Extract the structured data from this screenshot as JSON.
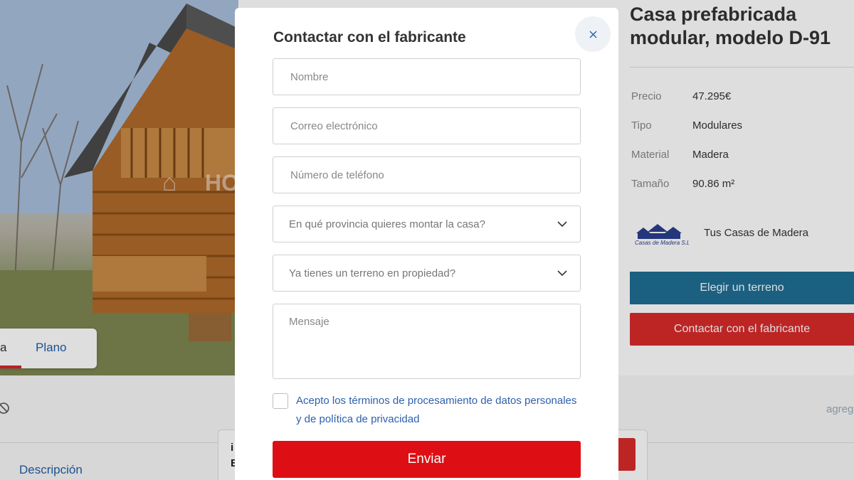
{
  "background": {
    "photo_tabs": {
      "tab_active_partial": "a",
      "tab_plan": "Plano"
    },
    "product": {
      "title": "Casa prefabricada modular, modelo D-91",
      "specs": [
        {
          "label": "Precio",
          "value": "47.295€"
        },
        {
          "label": "Tipo",
          "value": "Modulares"
        },
        {
          "label": "Material",
          "value": "Madera"
        },
        {
          "label": "Tamaño",
          "value": "90.86 m²"
        }
      ],
      "manufacturer": "Tus Casas de Madera",
      "manufacturer_logo_text": "Casas de Madera S.L",
      "choose_land_button": "Elegir un terreno",
      "contact_button": "Contactar con el fabricante"
    },
    "lower": {
      "partial_text_right": "agreg",
      "description_tab": "Descripción",
      "card_letters": [
        "i",
        "E"
      ]
    },
    "photo_watermark": "HO"
  },
  "modal": {
    "title": "Contactar con el fabricante",
    "fields": {
      "name_placeholder": "Nombre",
      "email_placeholder": "Correo electrónico",
      "phone_placeholder": "Número de teléfono",
      "province_select": "En qué provincia quieres montar la casa?",
      "land_select": "Ya tienes un terreno en propiedad?",
      "message_placeholder": "Mensaje"
    },
    "terms_text": "Acepto los términos de procesamiento de datos personales y de política de privacidad",
    "submit_label": "Enviar"
  },
  "colors": {
    "accent_red": "#dd0f14",
    "link_blue": "#2d5fae",
    "teal_button": "#1f6f95"
  }
}
